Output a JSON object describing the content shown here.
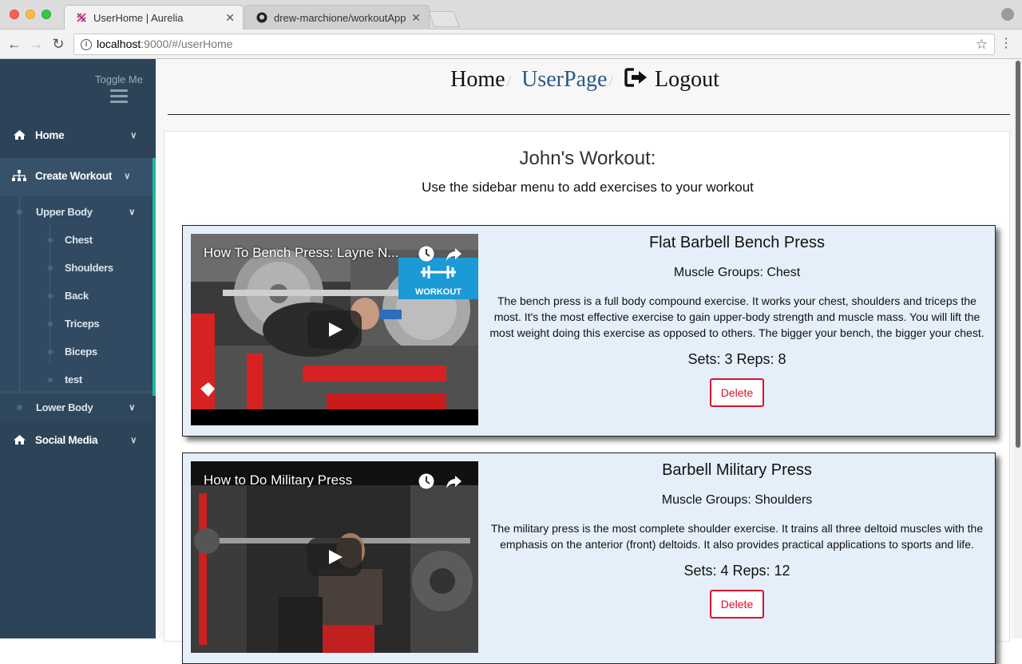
{
  "browser": {
    "tabs": [
      {
        "label": "UserHome | Aurelia",
        "active": true
      },
      {
        "label": "drew-marchione/workoutApp",
        "active": false
      }
    ],
    "url_host": "localhost",
    "url_rest": ":9000/#/userHome"
  },
  "sidebar": {
    "toggle_label": "Toggle Me",
    "items": {
      "home": "Home",
      "create_workout": "Create Workout",
      "upper_body": "Upper Body",
      "chest": "Chest",
      "shoulders": "Shoulders",
      "back": "Back",
      "triceps": "Triceps",
      "biceps": "Biceps",
      "test": "test",
      "lower_body": "Lower Body",
      "social_media": "Social Media"
    },
    "accent_color": "#1abc9c"
  },
  "breadcrumb": {
    "home": "Home",
    "userpage": "UserPage",
    "logout": "Logout",
    "separator": "/"
  },
  "workout": {
    "title": "John's Workout:",
    "subtitle": "Use the sidebar menu to add exercises to your workout",
    "exercises": [
      {
        "video_title": "How To Bench Press: Layne N...",
        "video_badge": "WORKOUT",
        "name": "Flat Barbell Bench Press",
        "muscles": "Muscle Groups: Chest",
        "description": "The bench press is a full body compound exercise. It works your chest, shoulders and triceps the most. It's the most effective exercise to gain upper-body strength and muscle mass. You will lift the most weight doing this exercise as opposed to others. The bigger your bench, the bigger your chest.",
        "sets_reps": "Sets: 3 Reps: 8",
        "delete_label": "Delete"
      },
      {
        "video_title": "How to Do Military Press",
        "name": "Barbell Military Press",
        "muscles": "Muscle Groups: Shoulders",
        "description": "The military press is the most complete shoulder exercise. It trains all three deltoid muscles with the emphasis on the anterior (front) deltoids. It also provides practical applications to sports and life.",
        "sets_reps": "Sets: 4 Reps: 12",
        "delete_label": "Delete"
      }
    ]
  }
}
